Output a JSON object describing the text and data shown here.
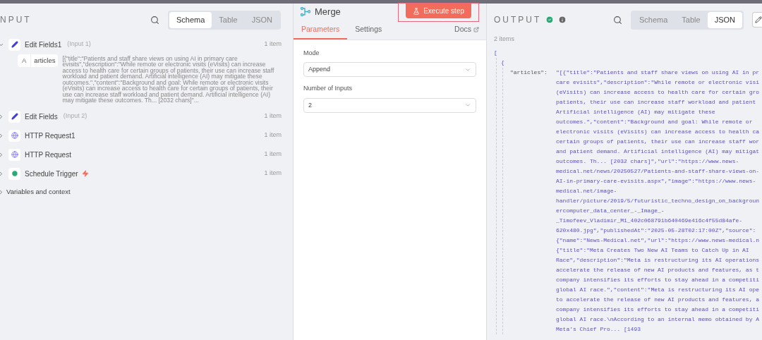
{
  "input": {
    "title": "NPUT",
    "tabs": [
      {
        "label": "Schema",
        "selected": true
      },
      {
        "label": "Table",
        "selected": false
      },
      {
        "label": "JSON",
        "selected": false
      }
    ],
    "nodes": [
      {
        "name": "Edit Fields1",
        "note": "(Input 1)",
        "count": "1 item",
        "kind": "edit",
        "expanded": true,
        "fields": [
          {
            "type": "A",
            "name": "articles",
            "value": "[{\"title\":\"Patients and staff share views on using AI in primary care evisits\",\"description\":\"While remote or electronic visits (eVisits) can increase access to health care for certain groups of patients, their use can increase staff workload and patient demand. Artificial intelligence (AI) may mitigate these outcomes.\",\"content\":\"Background and goal: While remote or electronic visits (eVisits) can increase access to health care for certain groups of patients, their use can increase staff workload and patient demand. Artificial intelligence (AI) may mitigate these outcomes. Th... [2032 chars]\"..."
          }
        ]
      },
      {
        "name": "Edit Fields",
        "note": "(Input 2)",
        "count": "1 item",
        "kind": "edit",
        "expanded": false
      },
      {
        "name": "HTTP Request1",
        "count": "1 item",
        "kind": "http",
        "expanded": false
      },
      {
        "name": "HTTP Request",
        "count": "1 item",
        "kind": "http",
        "expanded": false
      },
      {
        "name": "Schedule Trigger",
        "count": "1 item",
        "kind": "schedule",
        "trigger": true,
        "expanded": false
      }
    ],
    "variables": "Variables and context"
  },
  "node": {
    "title": "Merge",
    "execute": "Execute step",
    "tabs": [
      {
        "label": "Parameters",
        "selected": true
      },
      {
        "label": "Settings",
        "selected": false
      }
    ],
    "docs": "Docs",
    "params": [
      {
        "label": "Mode",
        "value": "Append"
      },
      {
        "label": "Number of Inputs",
        "value": "2"
      }
    ]
  },
  "output": {
    "title": "OUTPUT",
    "success": true,
    "tabs": [
      {
        "label": "Schema",
        "selected": false
      },
      {
        "label": "Table",
        "selected": false
      },
      {
        "label": "JSON",
        "selected": true
      }
    ],
    "count": "2 items",
    "open_bracket": "[",
    "open_brace": "{",
    "key": "\"articles\":",
    "lines": [
      "\"[{\"title\":\"Patients and staff share views on using AI in pr",
      "care evisits\",\"description\":\"While remote or electronic visi",
      "(eVisits) can increase access to health care for certain gro",
      "patients, their use can increase staff workload and patient",
      "Artificial intelligence (AI) may mitigate these",
      "outcomes.\",\"content\":\"Background and goal: While remote or",
      "electronic visits (eVisits) can increase access to health ca",
      "certain groups of patients, their use can increase staff wor",
      "and patient demand. Artificial intelligence (AI) may mitigat",
      "outcomes. Th... [2032 chars]\",\"url\":\"https://www.news-",
      "medical.net/news/20250527/Patients-and-staff-share-views-on-",
      "AI-in-primary-care-evisits.aspx\",\"image\":\"https://www.news-",
      "medical.net/image-",
      "handler/picture/2019/5/futuristic_techno_design_on_backgroun",
      "ercomputer_data_center_-_Image_-",
      "_Timofeev_Vladimir_M1_402c068791b640469e416c4f55d84afe-",
      "620x480.jpg\",\"publishedAt\":\"2025-05-28T02:17:00Z\",\"source\":",
      "{\"name\":\"News-Medical.net\",\"url\":\"https://www.news-medical.n",
      "{\"title\":\"Meta Creates Two New AI Teams to Catch Up in AI",
      "Race\",\"description\":\"Meta is restructuring its AI operations",
      "accelerate the release of new AI products and features, as t",
      "company intensifies its efforts to stay ahead in a competiti",
      "global AI race.\",\"content\":\"Meta is restructuring its AI ope",
      "to accelerate the release of new AI products and features, a",
      "company intensifies its efforts to stay ahead in a competiti",
      "global AI race.\\nAccording to an internal memo obtained by A",
      "Meta’s Chief Pro... [1493"
    ]
  }
}
